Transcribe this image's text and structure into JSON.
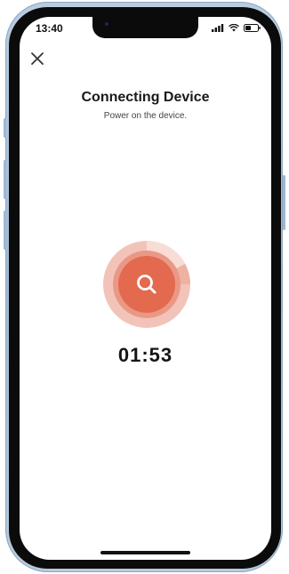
{
  "status_bar": {
    "time": "13:40",
    "icons": [
      "signal-icon",
      "wifi-icon",
      "battery-icon"
    ]
  },
  "header": {
    "close_icon": "close-icon"
  },
  "main": {
    "title": "Connecting Device",
    "subtitle": "Power on the device.",
    "search_icon": "search-icon",
    "timer": "01:53"
  },
  "colors": {
    "accent": "#e36a4e",
    "accent_light": "#f2c4b9",
    "frame": "#9fb8d1"
  }
}
